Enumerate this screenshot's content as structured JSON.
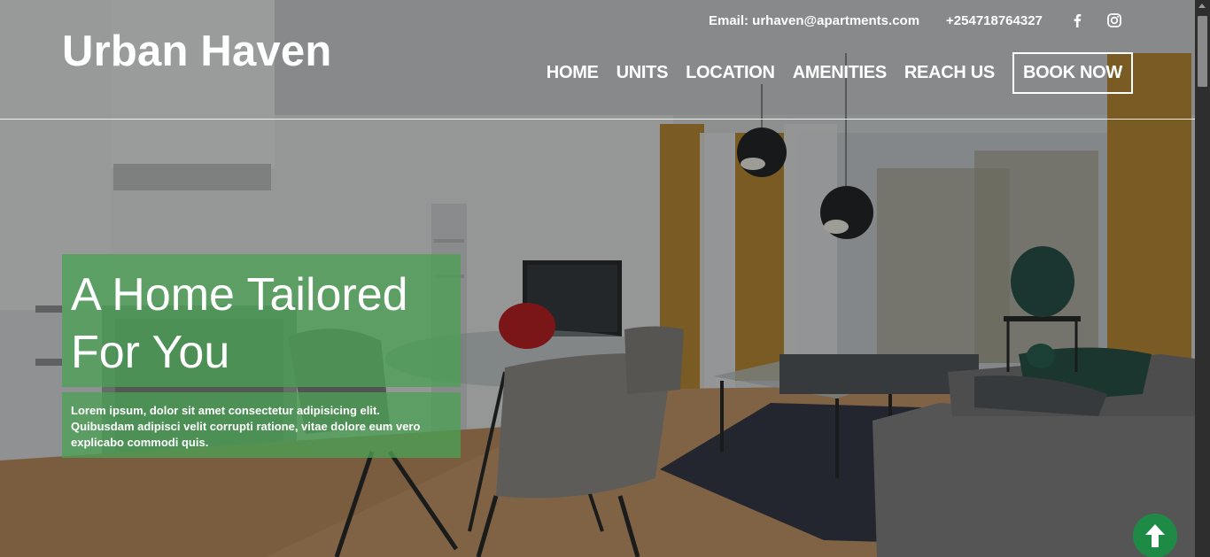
{
  "contact": {
    "email": "Email: urhaven@apartments.com",
    "phone": "+254718764327"
  },
  "social": [
    {
      "icon": "facebook-icon"
    },
    {
      "icon": "instagram-icon"
    }
  ],
  "brand": "Urban Haven",
  "nav": {
    "home": "HOME",
    "units": "UNITS",
    "location": "LOCATION",
    "amenities": "AMENITIES",
    "reach_us": "REACH US",
    "book_now": "BOOK NOW"
  },
  "hero": {
    "title": "A Home Tailored For You",
    "text": "Lorem ipsum, dolor sit amet consectetur adipisicing elit. Quibusdam adipisci velit corrupti ratione, vitae dolore eum vero explicabo commodi quis."
  },
  "colors": {
    "accent_green": "#4ca054",
    "back_to_top": "#1e8a46"
  },
  "icons": {
    "back_to_top": "arrow-up-icon"
  }
}
